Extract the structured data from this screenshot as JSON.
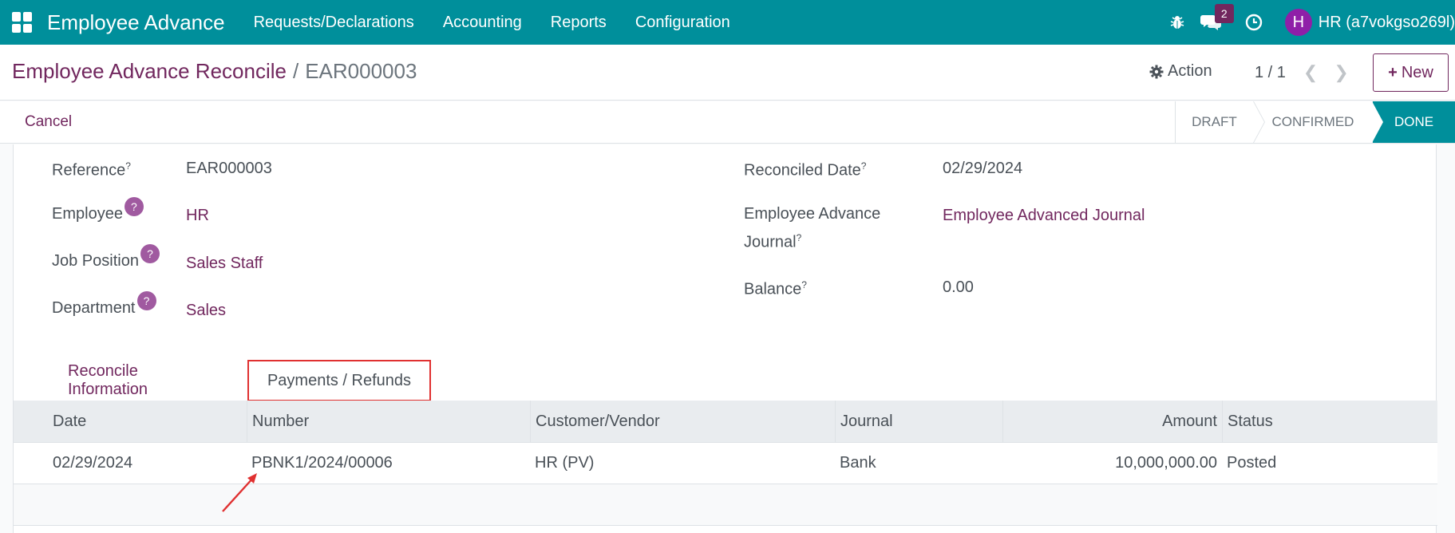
{
  "navbar": {
    "app_name": "Employee Advance",
    "menu": [
      "Requests/Declarations",
      "Accounting",
      "Reports",
      "Configuration"
    ],
    "messages_count": "2",
    "user_initial": "H",
    "user_name": "HR (a7vokgso269l)",
    "icons": [
      "apps-icon",
      "bug-icon",
      "chat-icon",
      "clock-icon"
    ]
  },
  "control": {
    "breadcrumb_parent": "Employee Advance Reconcile",
    "breadcrumb_separator": "/",
    "breadcrumb_current": "EAR000003",
    "action_label": "Action",
    "pager": "1 / 1",
    "new_label": "New"
  },
  "statusbar": {
    "cancel_label": "Cancel",
    "stages": [
      "DRAFT",
      "CONFIRMED",
      "DONE"
    ],
    "active_stage": "DONE"
  },
  "form": {
    "reference_label": "Reference",
    "reference_value": "EAR000003",
    "employee_label": "Employee",
    "employee_value": "HR",
    "job_label": "Job Position",
    "job_value": "Sales Staff",
    "department_label": "Department",
    "department_value": "Sales",
    "reconciled_date_label": "Reconciled Date",
    "reconciled_date_value": "02/29/2024",
    "journal_label_line1": "Employee Advance",
    "journal_label_line2": "Journal",
    "journal_value": "Employee Advanced Journal",
    "balance_label": "Balance",
    "balance_value": "0.00",
    "help_mark": "?",
    "tooltip_mark": "?"
  },
  "tabs": {
    "reconcile": "Reconcile Information",
    "payments": "Payments / Refunds"
  },
  "table": {
    "headers": [
      "Date",
      "Number",
      "Customer/Vendor",
      "Journal",
      "Amount",
      "Status"
    ],
    "rows": [
      [
        "02/29/2024",
        "PBNK1/2024/00006",
        "HR (PV)",
        "Bank",
        "10,000,000.00",
        "Posted"
      ]
    ]
  },
  "colors": {
    "navbar": "#008f9b",
    "brand": "#71275e",
    "highlight": "#e03131"
  }
}
